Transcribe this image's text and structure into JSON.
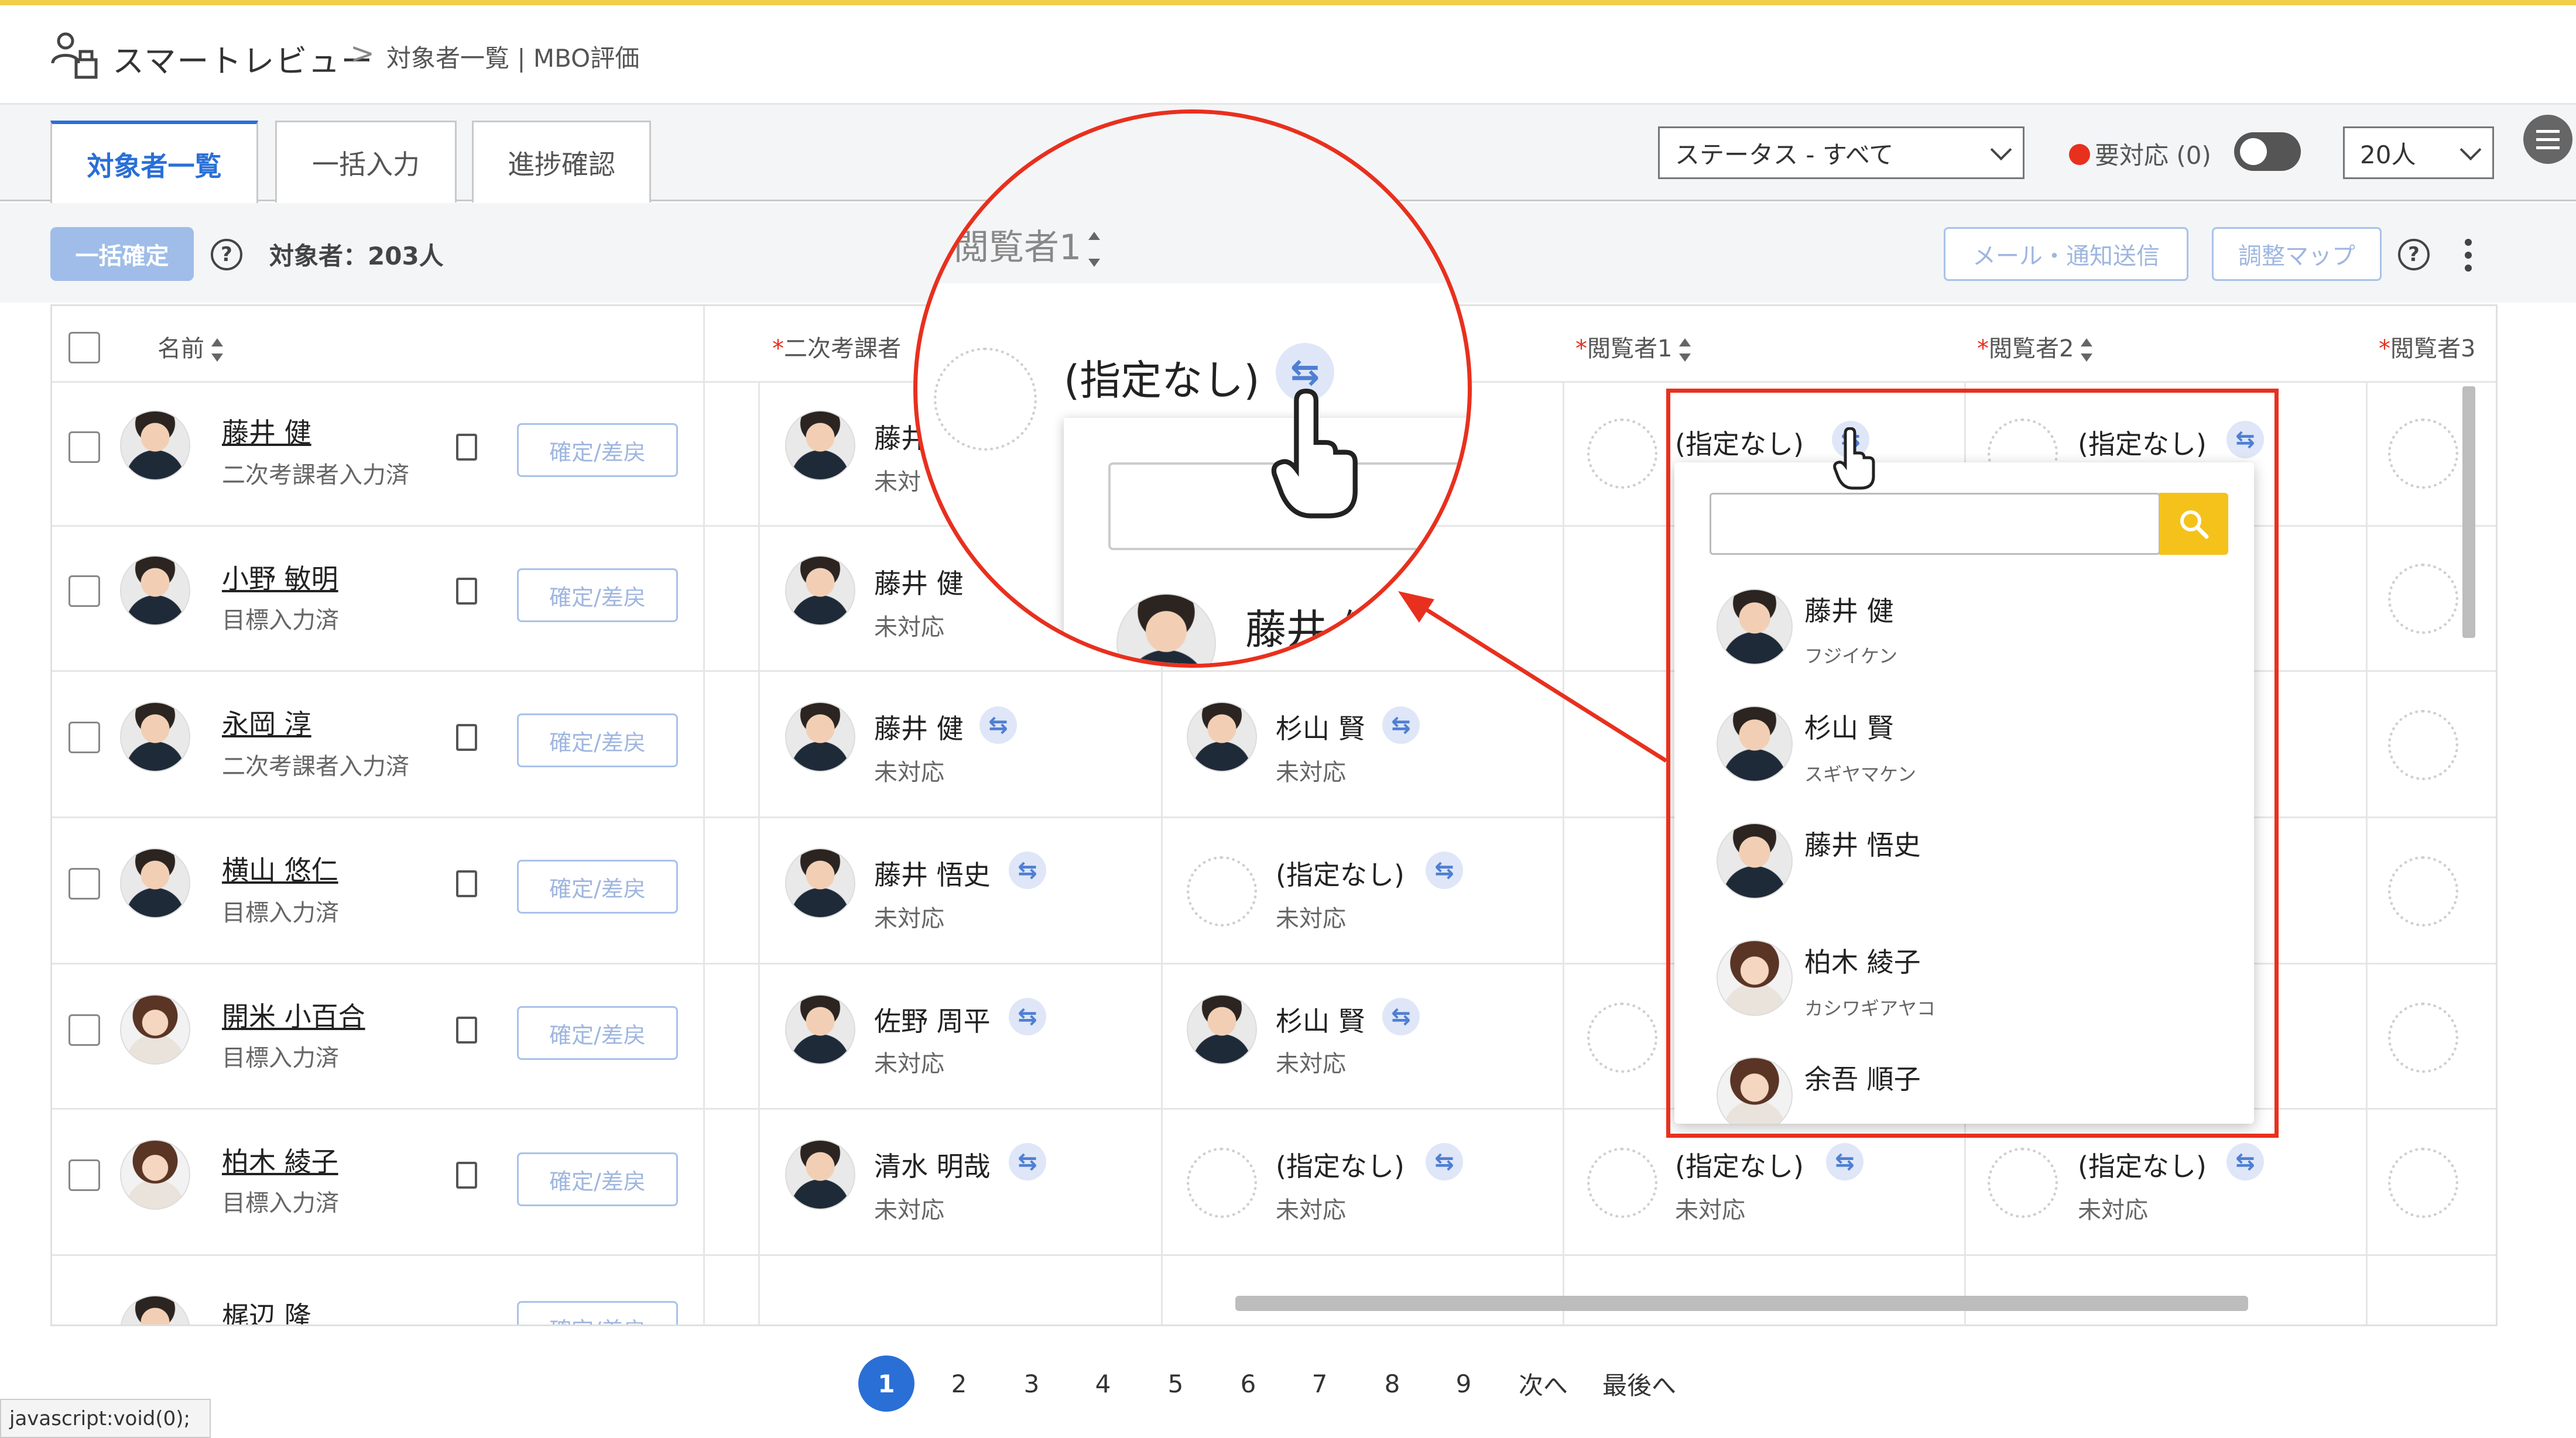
{
  "app": {
    "brand": "スマートレビュー",
    "breadcrumb_sep": ">",
    "breadcrumb_page": "対象者一覧 | MBO評価"
  },
  "tabs": [
    {
      "label": "対象者一覧"
    },
    {
      "label": "一括入力"
    },
    {
      "label": "進捗確認"
    }
  ],
  "filters": {
    "status_select": "ステータス - すべて",
    "needs_action_label": "要対応 (0)",
    "per_page_select": "20人"
  },
  "toolbar": {
    "bulk_confirm": "一括確定",
    "help": "?",
    "target_count": "対象者：203人",
    "mail_button": "メール・通知送信",
    "adjust_button": "調整マップ"
  },
  "table": {
    "headers": {
      "name": "名前",
      "second_evaluator": "二次考課者",
      "viewer1": "閲覧者1",
      "viewer2": "閲覧者2",
      "viewer3": "閲覧者3"
    },
    "confirm_label": "確定/差戻",
    "rows": [
      {
        "name": "藤井 健",
        "status": "二次考課者入力済",
        "second": "藤井",
        "second_status": "未対",
        "viewer1": "(指定なし)",
        "viewer2": "(指定なし)"
      },
      {
        "name": "小野 敏明",
        "status": "目標入力済",
        "second": "藤井 健",
        "second_status": "未対応"
      },
      {
        "name": "永岡 淳",
        "status": "二次考課者入力済",
        "second": "藤井 健",
        "second_status": "未対応",
        "third": "杉山 賢",
        "third_status": "未対応"
      },
      {
        "name": "横山 悠仁",
        "status": "目標入力済",
        "second": "藤井 悟史",
        "second_status": "未対応",
        "third": "(指定なし)",
        "third_status": "未対応"
      },
      {
        "name": "開米 小百合",
        "status": "目標入力済",
        "second": "佐野 周平",
        "second_status": "未対応",
        "third": "杉山 賢",
        "third_status": "未対応"
      },
      {
        "name": "柏木 綾子",
        "status": "目標入力済",
        "second": "清水 明哉",
        "second_status": "未対応",
        "third": "(指定なし)",
        "third_status": "未対応",
        "viewer1": "(指定なし)",
        "viewer1_status": "未対応",
        "viewer2": "(指定なし)",
        "viewer2_status": "未対応"
      },
      {
        "name": "梶辺 隆"
      }
    ]
  },
  "dropdown": {
    "items": [
      {
        "name": "藤井 健",
        "kana": "フジイケン"
      },
      {
        "name": "杉山 賢",
        "kana": "スギヤマケン"
      },
      {
        "name": "藤井 悟史",
        "kana": ""
      },
      {
        "name": "柏木 綾子",
        "kana": "カシワギアヤコ"
      },
      {
        "name": "余吾 順子",
        "kana": ""
      }
    ]
  },
  "magnifier": {
    "header": "閲覧者1",
    "value": "(指定なし)",
    "first_item": "藤井 健"
  },
  "pagination": {
    "pages": [
      "1",
      "2",
      "3",
      "4",
      "5",
      "6",
      "7",
      "8",
      "9"
    ],
    "next": "次へ",
    "last": "最後へ"
  },
  "statusbar": "javascript:void(0);",
  "colors": {
    "accent": "#2a6fd6",
    "highlight": "#e8301e",
    "search_button": "#f4c21a",
    "top_border": "#f2cf4a"
  }
}
